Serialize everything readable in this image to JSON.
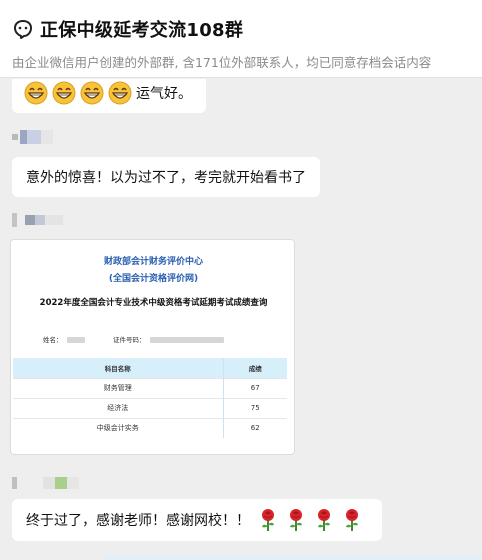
{
  "header": {
    "title": "正保中级延考交流108群",
    "subtitle": "由企业微信用户创建的外部群, 含171位外部联系人，均已同意存档会话内容"
  },
  "messages": [
    {
      "text": "运气好。",
      "emojis": [
        "grin-emoji",
        "grin-emoji",
        "grin-emoji",
        "grin-emoji"
      ]
    },
    {
      "text": "意外的惊喜！以为过不了，考完就开始看书了"
    },
    {
      "text": "终于过了，感谢老师！感谢网校！！",
      "emojis": [
        "rose-emoji",
        "rose-emoji",
        "rose-emoji",
        "rose-emoji"
      ]
    }
  ],
  "score_image": {
    "org_line1": "财政部会计财务评价中心",
    "org_line2": "(全国会计资格评价网)",
    "query_title": "2022年度全国会计专业技术中级资格考试延期考试成绩查询",
    "name_label": "姓名：",
    "id_label": "证件号码：",
    "table_headers": [
      "科目名称",
      "成绩"
    ],
    "rows": [
      {
        "subject": "财务管理",
        "score": "67"
      },
      {
        "subject": "经济法",
        "score": "75"
      },
      {
        "subject": "中级会计实务",
        "score": "62"
      }
    ]
  },
  "colors": {
    "header_bg": "#ffffff",
    "chat_bg": "#eeeeee",
    "bubble_bg": "#ffffff",
    "link_blue": "#2a5fb0",
    "table_header_bg": "#d7eefb"
  }
}
